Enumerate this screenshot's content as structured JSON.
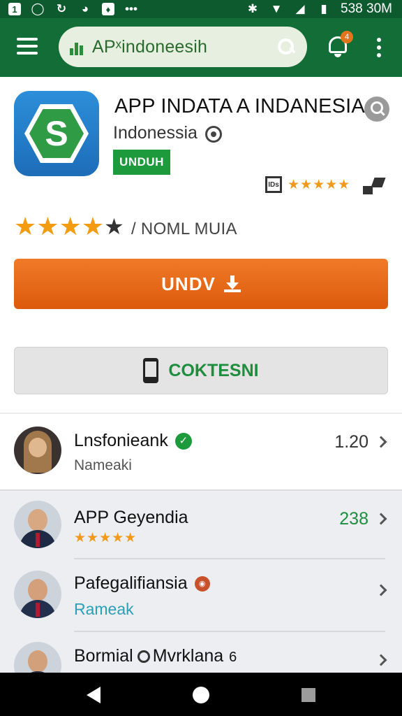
{
  "status_bar": {
    "time": "538 30M",
    "left_icons": [
      "notification-icon",
      "whatsapp-icon",
      "sync-icon",
      "alarm-icon",
      "card-icon",
      "more-dots-icon"
    ],
    "right_icons": [
      "bluetooth-icon",
      "wifi-icon",
      "signal-icon",
      "battery-icon"
    ]
  },
  "app_bar": {
    "search_text": "APˣindoneesih",
    "notification_count": "4"
  },
  "app": {
    "title": "APP INDATA A INDANESIA",
    "developer": "Indonessia",
    "chip_label": "UNDUH",
    "mini_rating_label": "IDs",
    "mini_stars": "★★★★★",
    "rating_value": 4,
    "rating_max": 5,
    "rating_text": "/ NOML MUIA"
  },
  "buttons": {
    "primary_label": "UNDV",
    "secondary_label": "COKTESNI"
  },
  "list": [
    {
      "name": "Lnsfonieank",
      "sub": "Nameaki",
      "value": "1.20",
      "verified": true
    },
    {
      "name": "APP Geyendia",
      "stars": "★★★★★",
      "value": "238"
    },
    {
      "name": "Pafegalifiansia",
      "sub": "Rameak",
      "value": ""
    },
    {
      "name_a": "Bormial",
      "name_b": "Mvrklana",
      "suffix": "6",
      "value": ""
    }
  ],
  "colors": {
    "app_bar": "#136d36",
    "status_bar": "#0c5a2e",
    "primary_button": "#e86a1a",
    "accent_green": "#1c9a3c",
    "star": "#f39c12",
    "link_teal": "#2aa0b8"
  }
}
